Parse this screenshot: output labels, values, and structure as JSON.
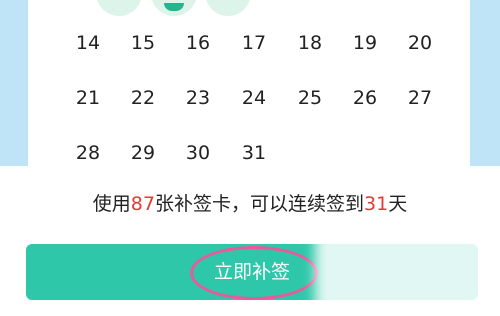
{
  "calendar": {
    "rows": [
      [
        "14",
        "15",
        "16",
        "17",
        "18",
        "19",
        "20"
      ],
      [
        "21",
        "22",
        "23",
        "24",
        "25",
        "26",
        "27"
      ],
      [
        "28",
        "29",
        "30",
        "31"
      ]
    ]
  },
  "summary": {
    "prefix": "使用",
    "card_count": "87",
    "middle": "张补签卡，可以连续签到",
    "days": "31",
    "suffix": "天"
  },
  "action": {
    "button_label": "立即补签"
  },
  "colors": {
    "accent": "#2ec7aa",
    "highlight": "#e53935",
    "ring": "#e85b9a",
    "side_panel": "#bfe3f7"
  }
}
